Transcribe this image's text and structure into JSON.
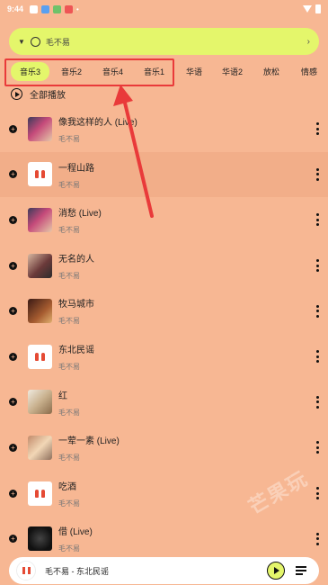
{
  "status": {
    "time": "9:44"
  },
  "search": {
    "text": "毛不易"
  },
  "tabs": [
    {
      "label": "音乐3",
      "active": true
    },
    {
      "label": "音乐2",
      "active": false
    },
    {
      "label": "音乐4",
      "active": false
    },
    {
      "label": "音乐1",
      "active": false
    },
    {
      "label": "华语",
      "active": false
    },
    {
      "label": "华语2",
      "active": false
    },
    {
      "label": "放松",
      "active": false
    },
    {
      "label": "情感",
      "active": false
    }
  ],
  "play_all": {
    "label": "全部播放"
  },
  "songs": [
    {
      "title": "像我这样的人 (Live)",
      "artist": "毛不易"
    },
    {
      "title": "一程山路",
      "artist": "毛不易"
    },
    {
      "title": "消愁 (Live)",
      "artist": "毛不易"
    },
    {
      "title": "无名的人",
      "artist": "毛不易"
    },
    {
      "title": "牧马城市",
      "artist": "毛不易"
    },
    {
      "title": "东北民谣",
      "artist": "毛不易"
    },
    {
      "title": "红",
      "artist": "毛不易"
    },
    {
      "title": "一荤一素 (Live)",
      "artist": "毛不易"
    },
    {
      "title": "吃酒",
      "artist": "毛不易"
    },
    {
      "title": "借 (Live)",
      "artist": "毛不易"
    }
  ],
  "player": {
    "now_playing": "毛不易 - 东北民谣"
  },
  "watermark": "芒果玩",
  "colors": {
    "background": "#f7b793",
    "accent": "#e4f66b",
    "highlight_box": "#e93a3a"
  }
}
